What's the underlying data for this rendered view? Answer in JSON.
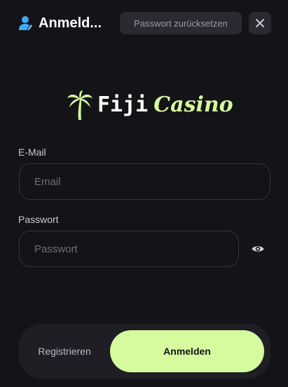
{
  "header": {
    "title": "Anmeld...",
    "user_icon": "user-icon",
    "reset_password_label": "Passwort zurücksetzen",
    "close_icon": "close-icon"
  },
  "logo": {
    "icon": "palm-tree-icon",
    "text_primary": "Fiji",
    "text_secondary": "Casino"
  },
  "form": {
    "email": {
      "label": "E-Mail",
      "placeholder": "Email",
      "value": ""
    },
    "password": {
      "label": "Passwort",
      "placeholder": "Passwort",
      "value": "",
      "toggle_icon": "eye-icon"
    }
  },
  "switch": {
    "register_label": "Registrieren",
    "login_label": "Anmelden",
    "active": "login"
  },
  "colors": {
    "background": "#141418",
    "surface": "#2a2a31",
    "accent": "#d6fa9e",
    "user_icon": "#3fa9f5"
  }
}
